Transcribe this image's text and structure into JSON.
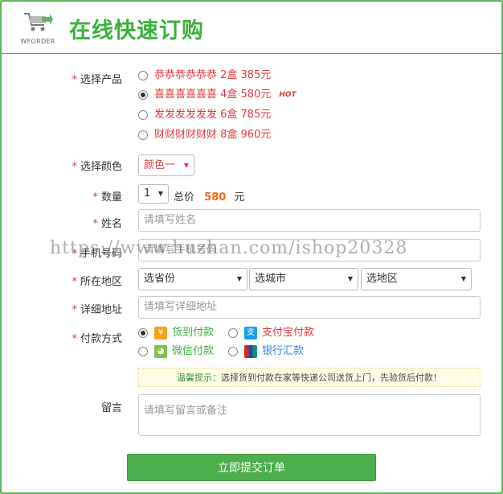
{
  "header": {
    "brand": "WFORDER",
    "title": "在线快速订购"
  },
  "form": {
    "product": {
      "label": "选择产品",
      "options": [
        {
          "text": "恭恭恭恭恭恭 2盒 385元",
          "checked": false
        },
        {
          "text": "喜喜喜喜喜喜 4盒 580元",
          "checked": true,
          "badge": "HOT"
        },
        {
          "text": "发发发发发发 6盒 785元",
          "checked": false
        },
        {
          "text": "财财财财财财 8盒 960元",
          "checked": false
        }
      ]
    },
    "color": {
      "label": "选择颜色",
      "value": "颜色一"
    },
    "quantity": {
      "label": "数量",
      "value": "1",
      "total_label": "总价",
      "total_value": "580",
      "unit": "元"
    },
    "name": {
      "label": "姓名",
      "placeholder": "请填写姓名"
    },
    "phone": {
      "label": "手机号码",
      "placeholder": "请填写手机号码"
    },
    "region": {
      "label": "所在地区",
      "province": "选省份",
      "city": "选城市",
      "district": "选地区"
    },
    "address": {
      "label": "详细地址",
      "placeholder": "请填写详细地址"
    },
    "payment": {
      "label": "付款方式",
      "options": [
        {
          "text": "货到付款",
          "checked": true,
          "color": "#3ab23a",
          "icon": "cod-icon"
        },
        {
          "text": "支付宝付款",
          "checked": false,
          "color": "#e4393c",
          "icon": "alipay-icon"
        },
        {
          "text": "微信付款",
          "checked": false,
          "color": "#3ab23a",
          "icon": "wechat-icon"
        },
        {
          "text": "银行汇款",
          "checked": false,
          "color": "#2a8ad4",
          "icon": "unionpay-icon"
        }
      ]
    },
    "tip": {
      "strong": "温馨提示：",
      "text": "选择货到付款在家等快递公司送货上门，先验货后付款！"
    },
    "message": {
      "label": "留言",
      "placeholder": "请填写留言或备注"
    },
    "submit": "立即提交订单"
  },
  "watermark": "https://www.huzhan.com/ishop20328",
  "colors": {
    "accent": "#4cae4c",
    "price": "#e4393c",
    "total": "#ff6600"
  }
}
